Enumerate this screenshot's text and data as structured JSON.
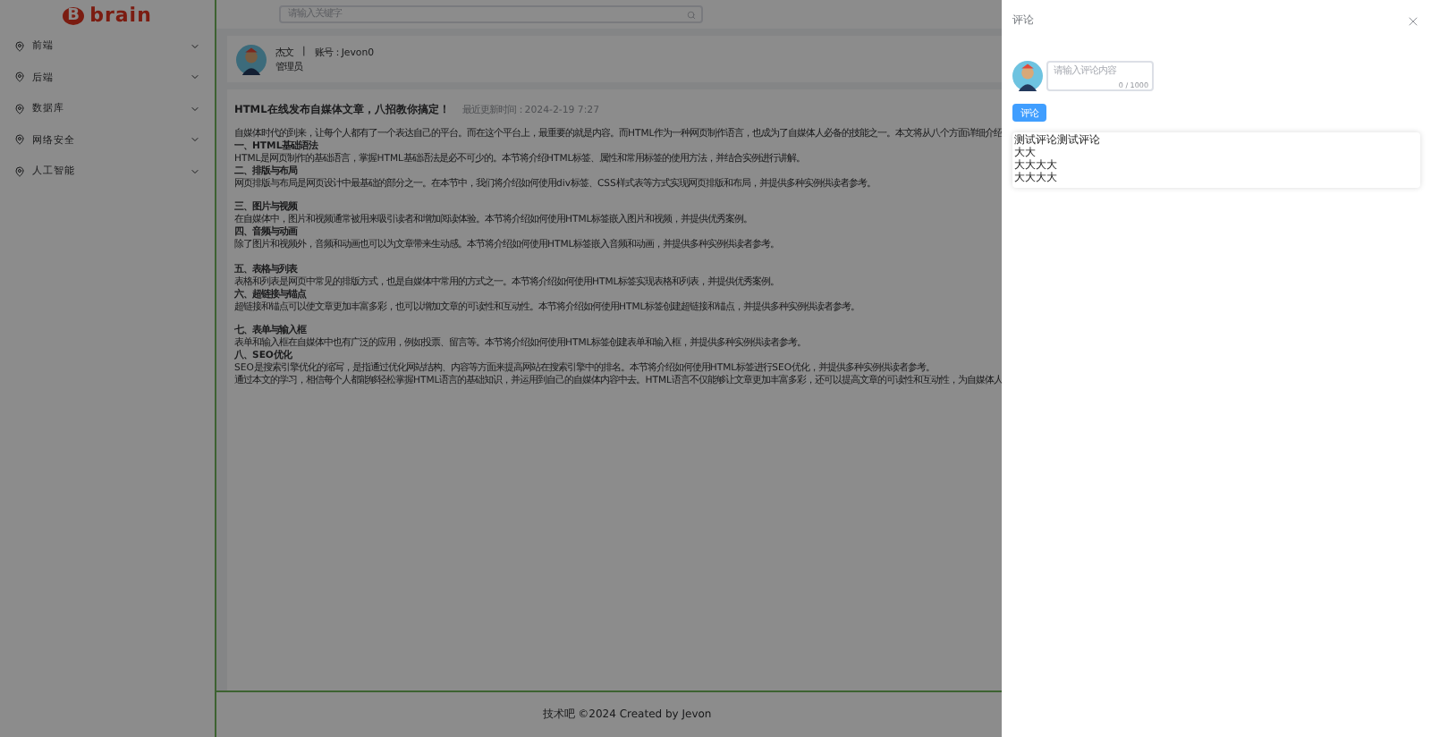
{
  "logo": {
    "badge": "B",
    "text": "brain"
  },
  "sidebar": {
    "items": [
      {
        "label": "前端",
        "expanded": false
      },
      {
        "label": "后端",
        "expanded": false
      },
      {
        "label": "数据库",
        "expanded": false
      },
      {
        "label": "网络安全",
        "expanded": false
      },
      {
        "label": "人工智能",
        "expanded": false
      }
    ]
  },
  "search": {
    "placeholder": "请输入关键字"
  },
  "author": {
    "name": "杰文",
    "separator": "|",
    "account_label": "账号：",
    "account": "Jevon0",
    "role": "管理员"
  },
  "article": {
    "title": "HTML在线发布自媒体文章，八招教你搞定！",
    "updated": "最近更新时间：2024-2-19 7:27",
    "intro": "自媒体时代的到来，让每个人都有了一个表达自己的平台。而在这个平台上，最重要的就是内容。而HTML作为一种网页制作语言，也成为了自媒体人必备的技能之一。本文将从八个方面详细介绍",
    "sections": [
      {
        "heading": "一、HTML基础语法",
        "text": "HTML是网页制作的基础语言，掌握HTML基础语法是必不可少的。本节将介绍HTML标签、属性和常用标签的使用方法，并结合实例进行讲解。",
        "spaced": false
      },
      {
        "heading": "二、排版与布局",
        "text": "网页排版与布局是网页设计中最基础的部分之一。在本节中，我们将介绍如何使用div标签、CSS样式表等方式实现网页排版和布局，并提供多种实例供读者参考。",
        "spaced": false
      },
      {
        "heading": "三、图片与视频",
        "text": "在自媒体中，图片和视频通常被用来吸引读者和增加阅读体验。本节将介绍如何使用HTML标签嵌入图片和视频，并提供优秀案例。",
        "spaced": true
      },
      {
        "heading": "四、音频与动画",
        "text": "除了图片和视频外，音频和动画也可以为文章带来生动感。本节将介绍如何使用HTML标签嵌入音频和动画，并提供多种实例供读者参考。",
        "spaced": false
      },
      {
        "heading": "五、表格与列表",
        "text": "表格和列表是网页中常见的排版方式，也是自媒体中常用的方式之一。本节将介绍如何使用HTML标签实现表格和列表，并提供优秀案例。",
        "spaced": true
      },
      {
        "heading": "六、超链接与锚点",
        "text": "超链接和锚点可以使文章更加丰富多彩，也可以增加文章的可读性和互动性。本节将介绍如何使用HTML标签创建超链接和锚点，并提供多种实例供读者参考。",
        "spaced": false
      },
      {
        "heading": "七、表单与输入框",
        "text": "表单和输入框在自媒体中也有广泛的应用，例如投票、留言等。本节将介绍如何使用HTML标签创建表单和输入框，并提供多种实例供读者参考。",
        "spaced": true
      },
      {
        "heading": "八、SEO优化",
        "text": "SEO是搜索引擎优化的缩写，是指通过优化网站结构、内容等方面来提高网站在搜索引擎中的排名。本节将介绍如何使用HTML标签进行SEO优化，并提供多种实例供读者参考。",
        "spaced": false
      }
    ],
    "outro": "通过本文的学习，相信每个人都能够轻松掌握HTML语言的基础知识，并运用到自己的自媒体内容中去。HTML语言不仅能够让文章更加丰富多彩，还可以提高文章的可读性和互动性，为自媒体人"
  },
  "footer": "技术吧 ©2024 Created by Jevon",
  "drawer": {
    "title": "评论",
    "comment_field": {
      "placeholder": "请输入评论内容",
      "counter": "0 / 1000"
    },
    "submit": "评论",
    "comments": [
      "测试评论测试评论",
      "大大",
      "大大大大",
      "大大大大"
    ]
  }
}
